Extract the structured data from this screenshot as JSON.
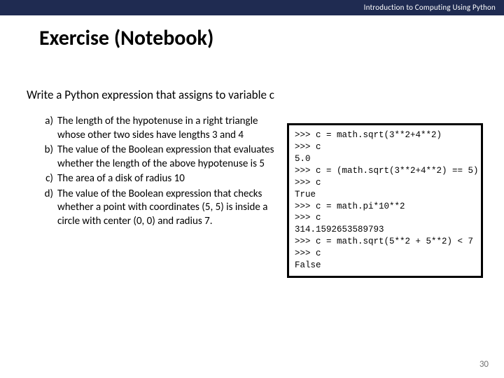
{
  "header": {
    "course": "Introduction to Computing Using Python"
  },
  "title": "Exercise (Notebook)",
  "prompt": "Write a Python expression that assigns to variable c",
  "items": [
    {
      "marker": "a)",
      "text": "The length of the hypotenuse in a right triangle whose other two sides have lengths 3 and 4"
    },
    {
      "marker": "b)",
      "text": "The value of the Boolean expression that evaluates whether the length of the above hypotenuse is 5"
    },
    {
      "marker": "c)",
      "text": "The area of a disk of radius 10"
    },
    {
      "marker": "d)",
      "text": "The value of the Boolean expression that checks whether a point with coordinates (5, 5) is inside a circle with center (0, 0) and radius 7."
    }
  ],
  "code": ">>> c = math.sqrt(3**2+4**2)\n>>> c\n5.0\n>>> c = (math.sqrt(3**2+4**2) == 5)\n>>> c\nTrue\n>>> c = math.pi*10**2\n>>> c\n314.1592653589793\n>>> c = math.sqrt(5**2 + 5**2) < 7\n>>> c\nFalse",
  "pagenum": "30"
}
